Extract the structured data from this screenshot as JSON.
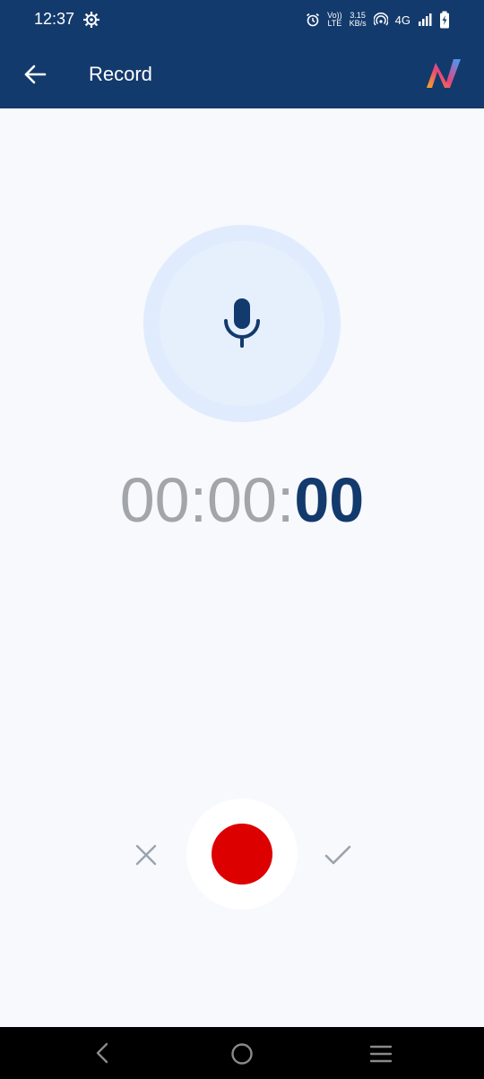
{
  "status_bar": {
    "time": "12:37",
    "volte_top": "Vo))",
    "volte_bottom": "LTE",
    "speed_value": "3.15",
    "speed_unit": "KB/s",
    "network": "4G",
    "icons": [
      "settings-gear-icon",
      "alarm-icon",
      "hotspot-icon",
      "signal-icon",
      "battery-charging-icon"
    ]
  },
  "app_bar": {
    "title": "Record",
    "back_icon": "arrow-left-icon",
    "logo": "app-logo"
  },
  "recorder": {
    "timer_dim": "00:00:",
    "timer_active": "00",
    "mic_icon": "microphone-icon",
    "record_color": "#dd0000"
  },
  "controls": {
    "cancel_icon": "close-icon",
    "record_button": "record-button",
    "confirm_icon": "check-icon"
  },
  "colors": {
    "primary": "#133a6c",
    "background": "#f7f9fc",
    "mic_circle": "#e0ecfd",
    "timer_dim": "#a2a5a9",
    "record": "#dd0000"
  },
  "nav_bar": {
    "icons": [
      "nav-back-icon",
      "nav-home-icon",
      "nav-menu-icon"
    ]
  }
}
